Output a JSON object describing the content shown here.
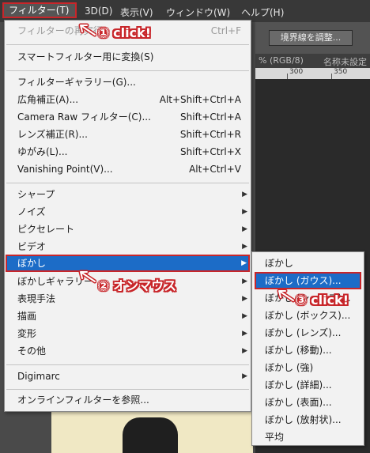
{
  "menubar": {
    "items": [
      "フィルター(T)",
      "3D(D)",
      "表示(V)",
      "ウィンドウ(W)",
      "ヘルプ(H)"
    ]
  },
  "workspace": {
    "refine_button": "境界線を調整...",
    "tab_partial": "% (RGB/8)",
    "tab2": "名称未設定",
    "ruler_labels": [
      "300",
      "350"
    ]
  },
  "filter_menu": {
    "last_filter": {
      "label": "フィルターの再実行",
      "shortcut": "Ctrl+F"
    },
    "smart": {
      "label": "スマートフィルター用に変換(S)"
    },
    "gallery": {
      "label": "フィルターギャラリー(G)..."
    },
    "adaptive_wide": {
      "label": "広角補正(A)...",
      "shortcut": "Alt+Shift+Ctrl+A"
    },
    "camera_raw": {
      "label": "Camera Raw フィルター(C)...",
      "shortcut": "Shift+Ctrl+A"
    },
    "lens": {
      "label": "レンズ補正(R)...",
      "shortcut": "Shift+Ctrl+R"
    },
    "liquify": {
      "label": "ゆがみ(L)...",
      "shortcut": "Shift+Ctrl+X"
    },
    "vanishing": {
      "label": "Vanishing Point(V)...",
      "shortcut": "Alt+Ctrl+V"
    },
    "sharpen": {
      "label": "シャープ"
    },
    "noise": {
      "label": "ノイズ"
    },
    "pixelate": {
      "label": "ピクセレート"
    },
    "video": {
      "label": "ビデオ"
    },
    "blur": {
      "label": "ぼかし"
    },
    "blur_gallery": {
      "label": "ぼかしギャラリー"
    },
    "stylize": {
      "label": "表現手法"
    },
    "render": {
      "label": "描画"
    },
    "distort": {
      "label": "変形"
    },
    "other": {
      "label": "その他"
    },
    "digimarc": {
      "label": "Digimarc"
    },
    "browse": {
      "label": "オンラインフィルターを参照..."
    }
  },
  "blur_submenu": {
    "items": [
      "ぼかし",
      "ぼかし (ガウス)...",
      "ぼかし (シェイプ)...",
      "ぼかし (ボックス)...",
      "ぼかし (レンズ)...",
      "ぼかし (移動)...",
      "ぼかし (強)",
      "ぼかし (詳細)...",
      "ぼかし (表面)...",
      "ぼかし (放射状)...",
      "平均"
    ]
  },
  "annotations": {
    "step1": "① click!",
    "step2": "② オンマウス",
    "step3": "③ click!"
  },
  "icons": {
    "submenu_arrow": "▶",
    "annotation_arrow": "arrow-icon"
  },
  "colors": {
    "highlight": "#1c6cc7",
    "annotation": "#c8262a"
  }
}
